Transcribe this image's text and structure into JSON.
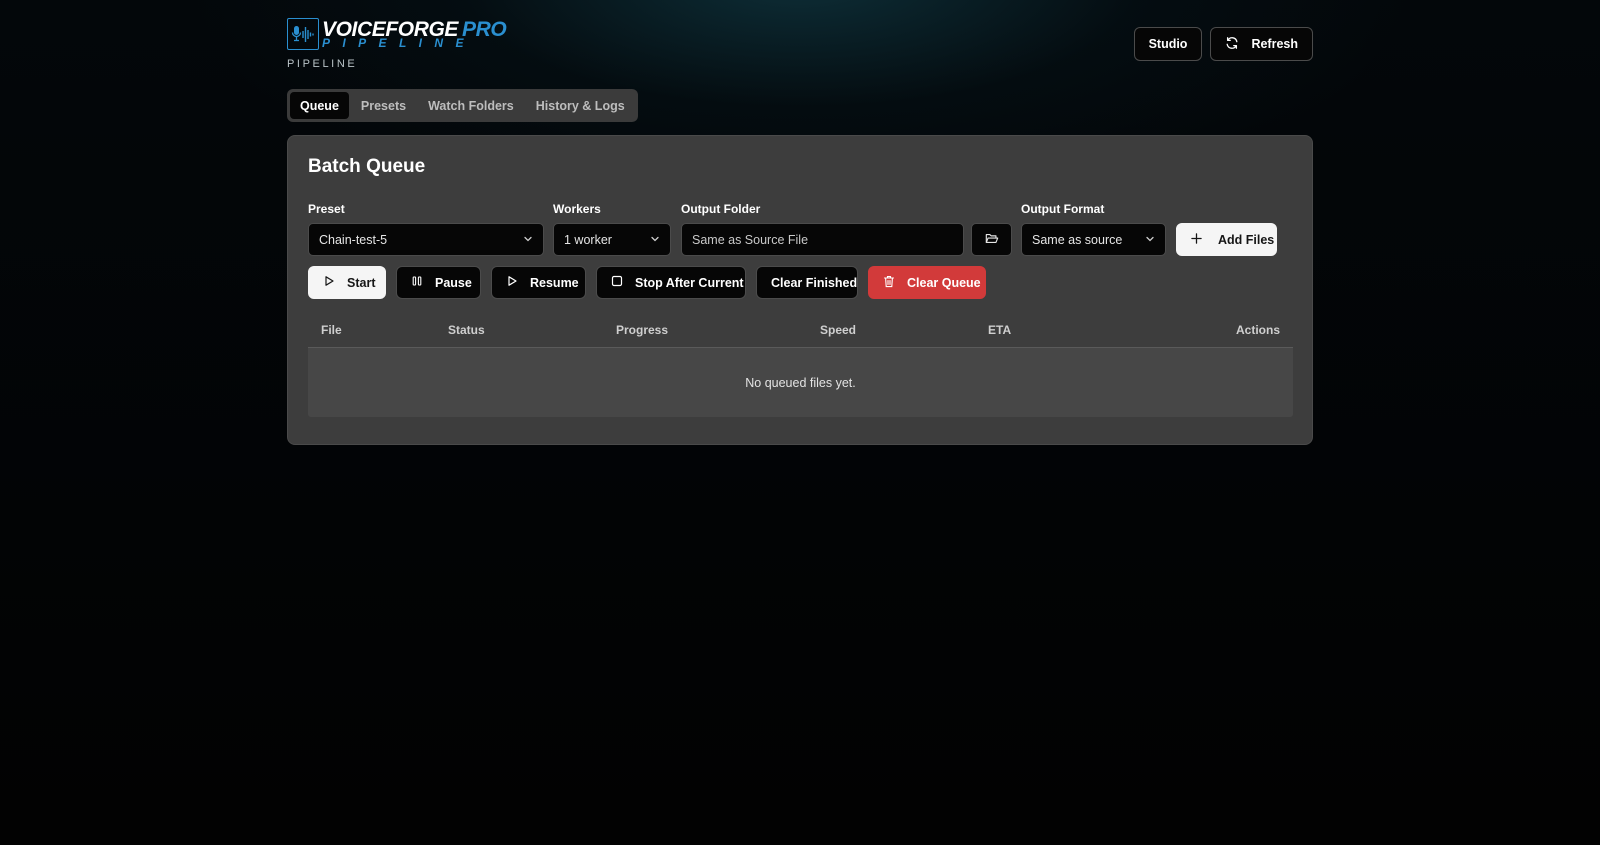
{
  "brand": {
    "logo_main": "VOICEFORGE",
    "logo_pro": "PRO",
    "logo_sub": "PIPELINE",
    "caption": "PIPELINE",
    "accent_color": "#2a8fd0"
  },
  "header": {
    "studio_label": "Studio",
    "refresh_label": "Refresh"
  },
  "tabs": [
    {
      "label": "Queue",
      "active": true
    },
    {
      "label": "Presets",
      "active": false
    },
    {
      "label": "Watch Folders",
      "active": false
    },
    {
      "label": "History & Logs",
      "active": false
    }
  ],
  "queue": {
    "title": "Batch Queue",
    "preset": {
      "label": "Preset",
      "value": "Chain-test-5"
    },
    "workers": {
      "label": "Workers",
      "value": "1 worker"
    },
    "output_folder": {
      "label": "Output Folder",
      "placeholder": "Same as Source File"
    },
    "output_format": {
      "label": "Output Format",
      "value": "Same as source"
    },
    "add_files_label": "Add Files",
    "controls": {
      "start": "Start",
      "pause": "Pause",
      "resume": "Resume",
      "stop_after_current": "Stop After Current",
      "clear_finished": "Clear Finished",
      "clear_queue": "Clear Queue"
    },
    "columns": [
      "File",
      "Status",
      "Progress",
      "Speed",
      "ETA",
      "Actions"
    ],
    "empty_message": "No queued files yet.",
    "danger_color": "#d23a3a"
  }
}
